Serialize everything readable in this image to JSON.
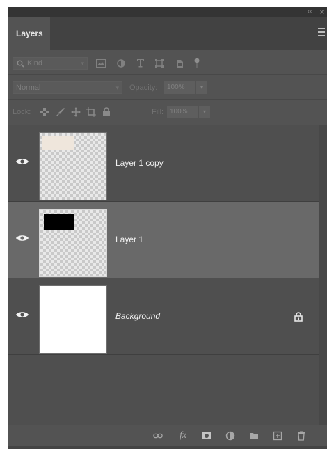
{
  "panel": {
    "title": "Layers",
    "collapse_icon": "double-chevron-left-icon",
    "close_icon": "close-icon",
    "collapse_glyph": "‹‹",
    "close_glyph": "×"
  },
  "filter": {
    "kind_label": "Kind",
    "icons": [
      "image-filter-icon",
      "adjustment-filter-icon",
      "type-filter-icon",
      "shape-filter-icon",
      "smart-object-filter-icon",
      "filter-toggle-icon"
    ]
  },
  "blend": {
    "mode": "Normal",
    "opacity_label": "Opacity:",
    "opacity_value": "100%"
  },
  "lock": {
    "label": "Lock:",
    "fill_label": "Fill:",
    "fill_value": "100%"
  },
  "layers": [
    {
      "name": "Layer 1 copy",
      "visible": true,
      "selected": false,
      "locked": false,
      "italic": false,
      "mark_color": "#efe6dc"
    },
    {
      "name": "Layer 1",
      "visible": true,
      "selected": true,
      "locked": false,
      "italic": false,
      "mark_color": "#000000"
    },
    {
      "name": "Background",
      "visible": true,
      "selected": false,
      "locked": true,
      "italic": true,
      "mark_color": "#ffffff"
    }
  ],
  "bottom_icons": [
    "link-layers-icon",
    "fx-icon",
    "add-mask-icon",
    "adjustment-layer-icon",
    "new-group-icon",
    "new-layer-icon",
    "delete-icon"
  ],
  "fx_glyph": "fx",
  "colors": {
    "panel_bg": "#535353",
    "selected_row": "#696969",
    "text": "#f0f0f0"
  }
}
